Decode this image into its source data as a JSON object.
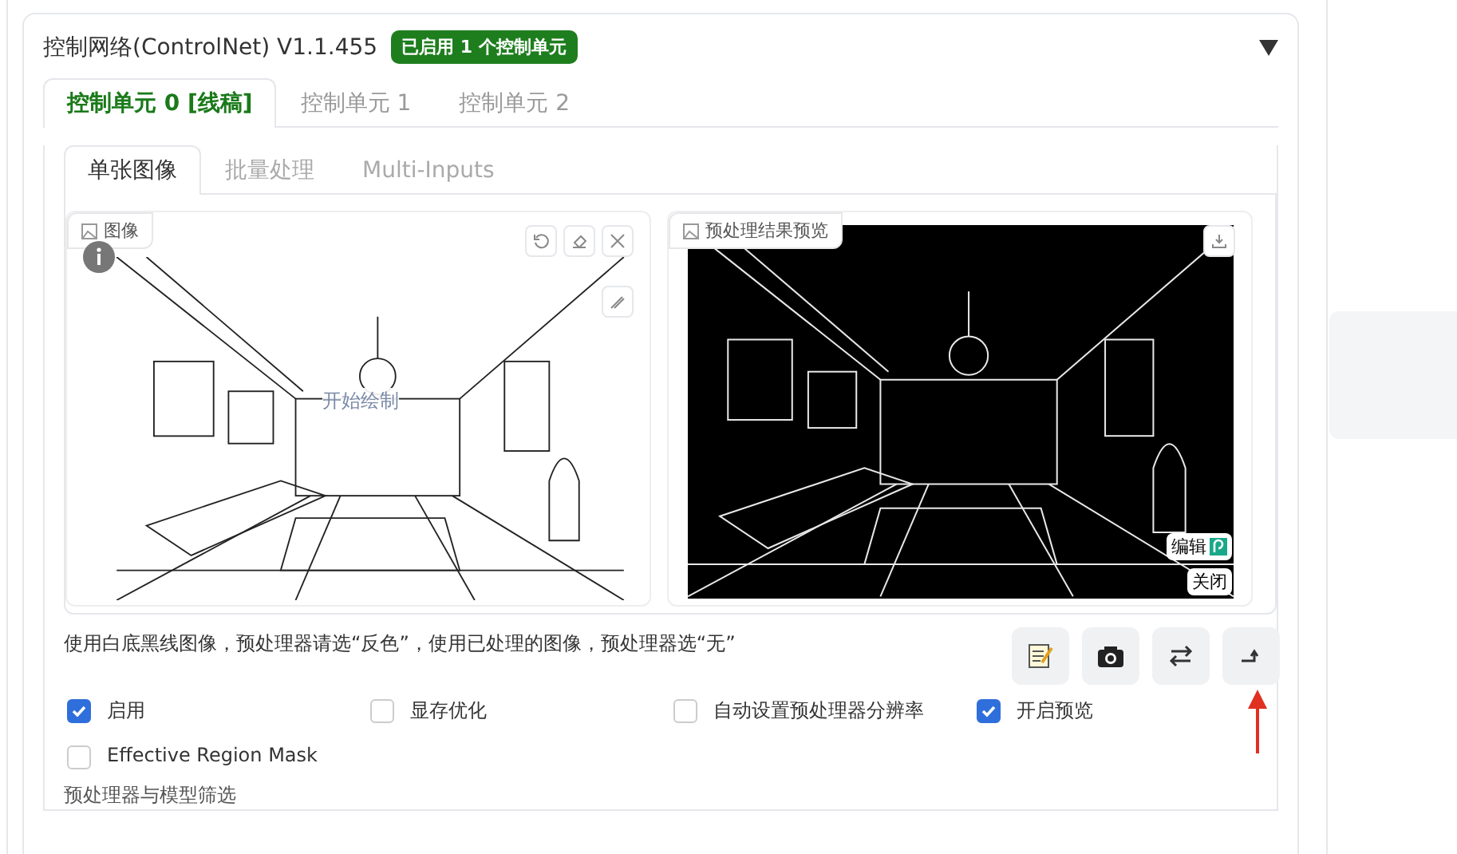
{
  "panel": {
    "title": "控制网络(ControlNet) V1.1.455",
    "badge": "已启用 1 个控制单元",
    "expanded": true
  },
  "unit_tabs": [
    {
      "label": "控制单元 0 [线稿]",
      "selected": true
    },
    {
      "label": "控制单元 1",
      "selected": false
    },
    {
      "label": "控制单元 2",
      "selected": false
    }
  ],
  "mode_tabs": [
    {
      "label": "单张图像",
      "selected": true
    },
    {
      "label": "批量处理",
      "selected": false
    },
    {
      "label": "Multi-Inputs",
      "selected": false
    }
  ],
  "input_image": {
    "label": "图像",
    "overlay_text": "开始绘制"
  },
  "preview_image": {
    "label": "预处理结果预览",
    "edit_button": "编辑",
    "close_button": "关闭"
  },
  "hint": "使用白底黑线图像，预处理器请选“反色”，使用已处理的图像，预处理器选“无”",
  "options": [
    {
      "label": "启用",
      "checked": true
    },
    {
      "label": "显存优化",
      "checked": false
    },
    {
      "label": "自动设置预处理器分辨率",
      "checked": false
    },
    {
      "label": "开启预览",
      "checked": true
    },
    {
      "label": "Effective Region Mask",
      "checked": false
    }
  ],
  "section_label": "预处理器与模型筛选"
}
